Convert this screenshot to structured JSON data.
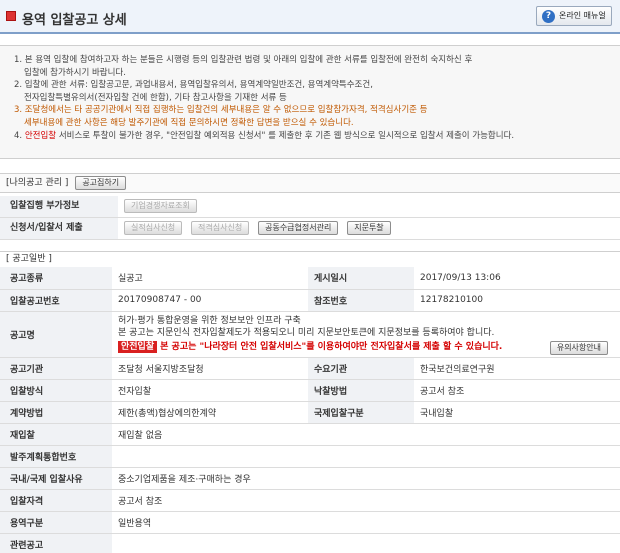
{
  "header": {
    "title": "용역 입찰공고 상세",
    "help_label": "온라인 매뉴얼",
    "help_glyph": "?"
  },
  "notice": {
    "n1a": "1. 본 용역 입찰에 참여하고자 하는 분들은 시행령 등의 입찰관련 법령 및 아래의 입찰에 관한 서류를 입찰전에 완전히 숙지하신 후",
    "n1b": "입찰에 참가하시기 바랍니다.",
    "n2a": "2. 입찰에 관한 서류: 입찰공고문, 과업내용서, 용역입찰유의서, 용역계약일반조건, 용역계약특수조건,",
    "n2b": "전자입찰특별유의서(전자입찰 건에 한함), 기타 참고사항을 기재한 서류 등",
    "n3a": "3. 조달청에서는 타 공공기관에서 직접 집행하는 입찰건의 세부내용은 알 수 없으므로 입찰참가자격, 적격심사기준 등",
    "n3b": "세부내용에 관한 사항은 해당 발주기관에 직접 문의하시면 정확한 답변을 받으실 수 있습니다.",
    "n4num": "4.",
    "n4red": "안전입찰",
    "n4rest": "서비스로 투찰이 불가한 경우, \"안전입찰 예외적용 신청서\" 를 제출한 후 기존 웹 방식으로 일시적으로 입찰서 제출이 가능합니다."
  },
  "my_notice": {
    "label": "[나의공고 관리 ]",
    "button": "공고집하기"
  },
  "exec_info": {
    "label": "입찰집행 부가정보",
    "buttons": [
      "기업경쟁자료조회"
    ]
  },
  "apply": {
    "label": "신청서/입찰서 제출",
    "buttons": [
      "실적심사신청",
      "적격심사신청",
      "공동수급협정서관리",
      "지문투찰"
    ]
  },
  "general": {
    "label": "[ 공고일반 ]",
    "type_label": "공고종류",
    "type_value": "실공고",
    "posted_label": "게시일시",
    "posted_value": "2017/09/13 13:06",
    "no_label": "입찰공고번호",
    "no_value": "20170908747 - 00",
    "ref_label": "참조번호",
    "ref_value": "12178210100",
    "name_label": "공고명",
    "name_line1": "허가·평가 통합운영을 위한 정보보안 인프라 구축",
    "name_line2": "본 공고는 지문인식 전자입찰제도가 적용되오니 미리 지문보안토큰에 지문정보를 등록하여야 합니다.",
    "safe_badge": "안전입찰",
    "safe_text": "본 공고는 \"나라장터 안전 입찰서비스\"를 이용하여야만 전자입찰서를 제출 할 수 있습니다.",
    "tip_button": "유의사항안내",
    "org_label": "공고기관",
    "org_value": "조달청 서울지방조달청",
    "demand_label": "수요기관",
    "demand_value": "한국보건의료연구원",
    "method_label": "입찰방식",
    "method_value": "전자입찰",
    "award_label": "낙찰방법",
    "award_value": "공고서 참조",
    "contract_label": "계약방법",
    "contract_value": "제한(총액)협상에의한계약",
    "intl_label": "국제입찰구분",
    "intl_value": "국내입찰",
    "rebid_label": "재입찰",
    "rebid_value": "재입찰 없음",
    "plan_label": "발주계획통합번호",
    "plan_value": "",
    "reason_label": "국내/국제 입찰사유",
    "reason_value": "중소기업제품을 제조·구매하는 경우",
    "qual_label": "입찰자격",
    "qual_value": "공고서 참조",
    "service_label": "용역구분",
    "service_value": "일반용역",
    "related_label": "관련공고",
    "related_value": ""
  }
}
